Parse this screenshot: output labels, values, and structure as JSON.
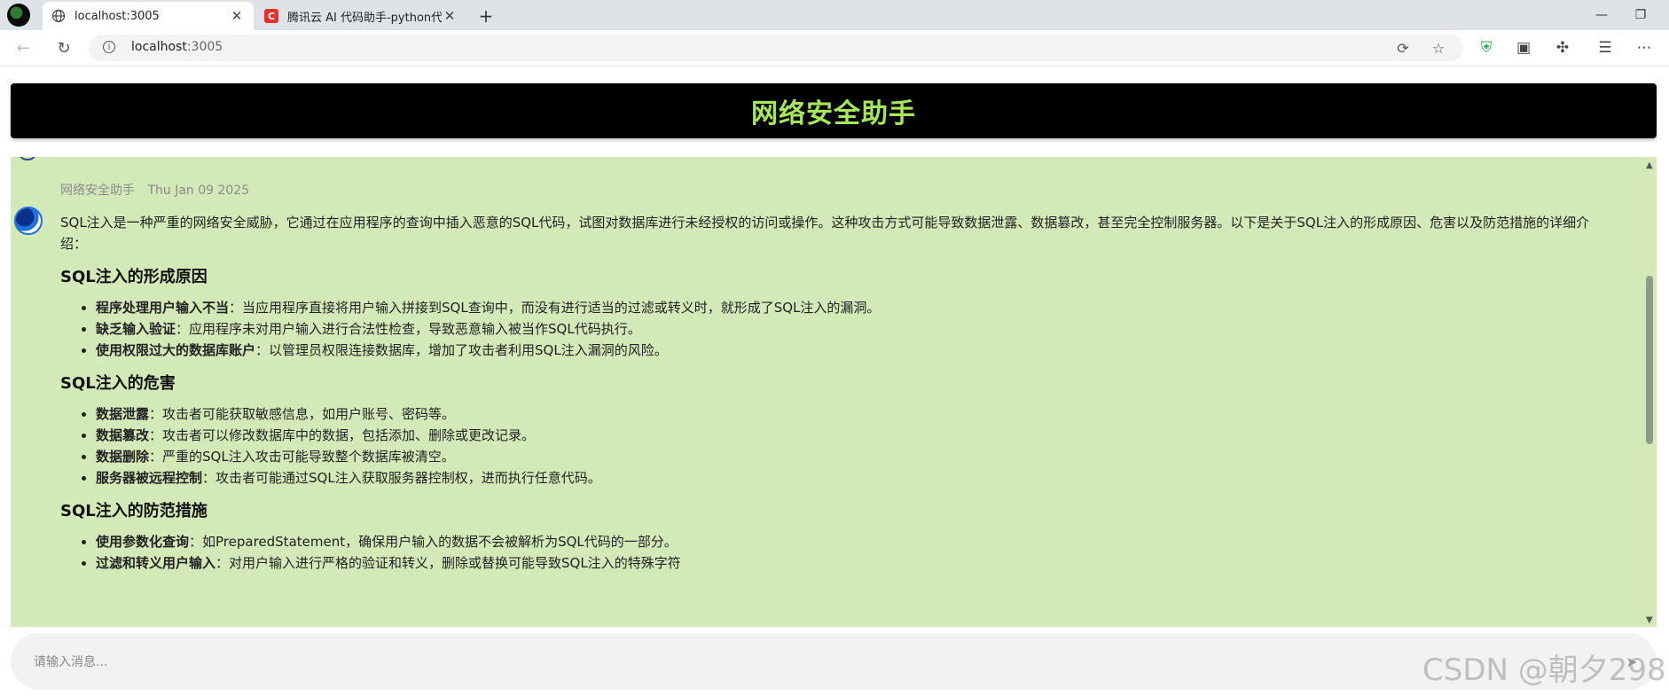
{
  "browser": {
    "tabs": [
      {
        "title": "localhost:3005",
        "active": true,
        "icon": "globe-icon"
      },
      {
        "title": "腾讯云 AI 代码助手-python代码开",
        "active": false,
        "icon": "csdn-c-icon"
      }
    ],
    "url_host": "localhost",
    "url_port": ":3005"
  },
  "app": {
    "title": "网络安全助手",
    "colors": {
      "header_bg": "#000000",
      "title": "#a6e85a",
      "chat_bg": "#d3e9b8"
    }
  },
  "message": {
    "sender": "网络安全助手",
    "date": "Thu Jan 09 2025",
    "intro": "SQL注入是一种严重的网络安全威胁，它通过在应用程序的查询中插入恶意的SQL代码，试图对数据库进行未经授权的访问或操作。这种攻击方式可能导致数据泄露、数据篡改，甚至完全控制服务器。以下是关于SQL注入的形成原因、危害以及防范措施的详细介绍：",
    "sections": [
      {
        "heading": "SQL注入的形成原因",
        "items": [
          {
            "term": "程序处理用户输入不当",
            "desc": "：当应用程序直接将用户输入拼接到SQL查询中，而没有进行适当的过滤或转义时，就形成了SQL注入的漏洞。"
          },
          {
            "term": "缺乏输入验证",
            "desc": "：应用程序未对用户输入进行合法性检查，导致恶意输入被当作SQL代码执行。"
          },
          {
            "term": "使用权限过大的数据库账户",
            "desc": "：以管理员权限连接数据库，增加了攻击者利用SQL注入漏洞的风险。"
          }
        ]
      },
      {
        "heading": "SQL注入的危害",
        "items": [
          {
            "term": "数据泄露",
            "desc": "：攻击者可能获取敏感信息，如用户账号、密码等。"
          },
          {
            "term": "数据篡改",
            "desc": "：攻击者可以修改数据库中的数据，包括添加、删除或更改记录。"
          },
          {
            "term": "数据删除",
            "desc": "：严重的SQL注入攻击可能导致整个数据库被清空。"
          },
          {
            "term": "服务器被远程控制",
            "desc": "：攻击者可能通过SQL注入获取服务器控制权，进而执行任意代码。"
          }
        ]
      },
      {
        "heading": "SQL注入的防范措施",
        "items": [
          {
            "term": "使用参数化查询",
            "desc": "：如PreparedStatement，确保用户输入的数据不会被解析为SQL代码的一部分。"
          },
          {
            "term": "过滤和转义用户输入",
            "desc": "：对用户输入进行严格的验证和转义，删除或替换可能导致SQL注入的特殊字符"
          }
        ]
      }
    ]
  },
  "input": {
    "placeholder": "请输入消息..."
  },
  "watermark": "CSDN @朝夕298"
}
